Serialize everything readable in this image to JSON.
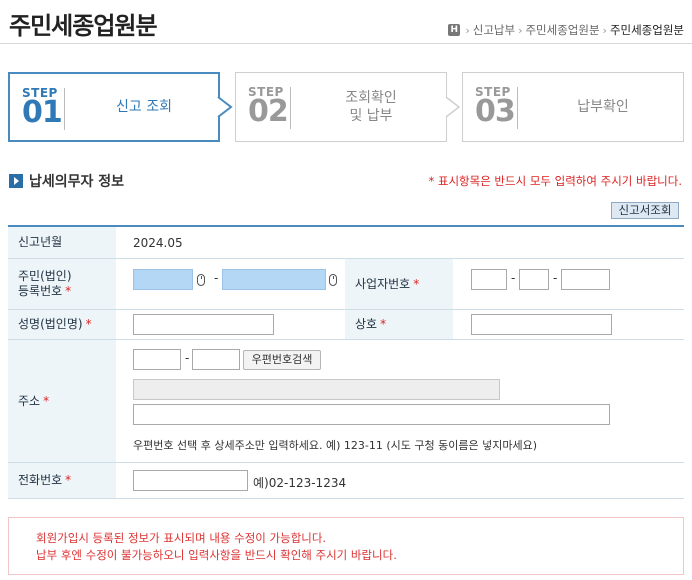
{
  "header": {
    "title": "주민세종업원분",
    "breadcrumb": {
      "home_icon": "H",
      "items": [
        "신고납부",
        "주민세종업원분"
      ],
      "current": "주민세종업원분"
    }
  },
  "steps": [
    {
      "word": "STEP",
      "number": "01",
      "label": "신고 조회",
      "active": true
    },
    {
      "word": "STEP",
      "number": "02",
      "label_line1": "조회확인",
      "label_line2": "및 납부",
      "active": false
    },
    {
      "word": "STEP",
      "number": "03",
      "label": "납부확인",
      "active": false
    }
  ],
  "section": {
    "title": "납세의무자 정보",
    "required_note": "* 표시항목은 반드시 모두 입력하여 주시기 바랍니다.",
    "lookup_button": "신고서조회"
  },
  "form": {
    "report_month": {
      "label": "신고년월",
      "value": "2024.05"
    },
    "resident_number": {
      "label_line1": "주민(법인)",
      "label_line2": "등록번호",
      "req": "*",
      "value1": "",
      "value2": ""
    },
    "business_number": {
      "label": "사업자번호",
      "req": "*",
      "value1": "",
      "value2": "",
      "value3": ""
    },
    "name": {
      "label": "성명(법인명)",
      "req": "*",
      "value": ""
    },
    "company": {
      "label": "상호",
      "req": "*",
      "value": ""
    },
    "address": {
      "label": "주소",
      "req": "*",
      "zip1": "",
      "zip2": "",
      "zip_search_button": "우편번호검색",
      "address1": "",
      "address2": "",
      "help": "우편번호 선택 후 상세주소만 입력하세요. 예) 123-11 (시도 구청 동이름은 넣지마세요)"
    },
    "phone": {
      "label": "전화번호",
      "req": "*",
      "value": "",
      "example": "예)02-123-1234"
    },
    "dash": "-"
  },
  "notice": {
    "line1": "회원가입시 등록된 정보가 표시되며 내용 수정이 가능합니다.",
    "line2": "납부 후엔 수정이 불가능하오니 입력사항을 반드시 확인해 주시기 바랍니다."
  },
  "colors": {
    "accent": "#2f79b7",
    "required": "#dd2222",
    "masked_field": "#b4d7f5",
    "header_cell": "#eef5f8"
  }
}
